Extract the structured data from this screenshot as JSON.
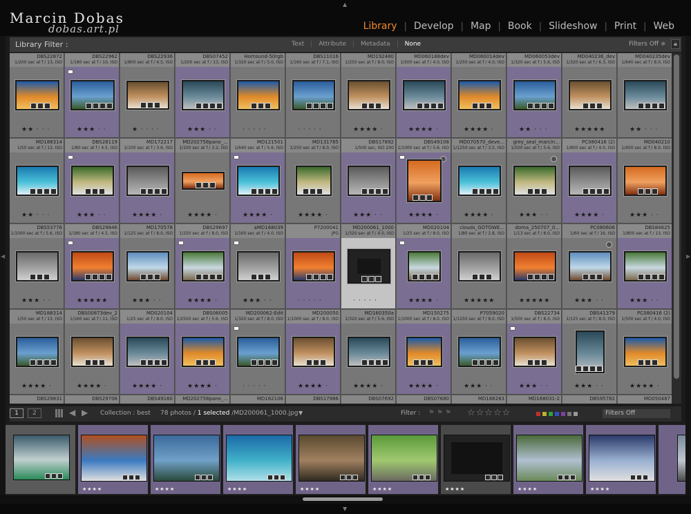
{
  "branding": {
    "name": "Marcin Dobas",
    "site": "dobas.art.pl"
  },
  "modules": [
    {
      "label": "Library",
      "active": true
    },
    {
      "label": "Develop"
    },
    {
      "label": "Map"
    },
    {
      "label": "Book"
    },
    {
      "label": "Slideshow"
    },
    {
      "label": "Print"
    },
    {
      "label": "Web"
    }
  ],
  "filter_bar": {
    "label": "Library Filter :",
    "options": [
      "Text",
      "Attribute",
      "Metadata",
      "None"
    ],
    "active": "None",
    "preset": "Filters Off ≑"
  },
  "grid": {
    "rows": [
      [
        {
          "name": "DBS22872",
          "exif": "1/200 sec at f / 13, ISO",
          "stars": 2
        },
        {
          "name": "DBS22962",
          "exif": "1/180 sec at f / 10, ISO",
          "stars": 3
        },
        {
          "name": "DBS22936",
          "exif": "1/800 sec at f / 4.5, ISO",
          "stars": 1
        },
        {
          "name": "DBS07452",
          "exif": "1/200 sec at f / 13, ISO",
          "stars": 3
        },
        {
          "name": "Hornsund-50rgb",
          "exif": "1/320 sec at f / 5.0, ISO",
          "stars": 0
        },
        {
          "name": "DBS11016",
          "exif": "1/160 sec at f / 7.1, ISO",
          "stars": 0
        },
        {
          "name": "MD192480",
          "exif": "1/250 sec at f / 8.0, ISO",
          "stars": 4
        },
        {
          "name": "MD060188dev",
          "exif": "1/500 sec at f / 4.0, ISO",
          "stars": 4
        },
        {
          "name": "MD060014dev",
          "exif": "1/250 sec at f / 4.0, ISO",
          "stars": 4
        },
        {
          "name": "MD060053dev",
          "exif": "1/320 sec at f / 5.6, ISO",
          "stars": 2
        },
        {
          "name": "MD040236_dev",
          "exif": "1/320 sec at f / 6.3, ISO",
          "stars": 5
        },
        {
          "name": "MD040235dev",
          "exif": "1/640 sec at f / 8.0, ISO",
          "stars": 2
        }
      ],
      [
        {
          "name": "MD188314",
          "exif": "1/50 sec at f / 13, ISO",
          "stars": 2
        },
        {
          "name": "DBS28119",
          "exif": "1/80 sec at f / 4.5, ISO",
          "stars": 3
        },
        {
          "name": "MD172217",
          "exif": "1/100 sec at f / 3.6, ISO",
          "stars": 4
        },
        {
          "name": "MD202758pano_...",
          "exif": "1/100 sec at f / 3.2, ISO",
          "stars": 4
        },
        {
          "name": "MD121501",
          "exif": "1/640 sec at f / 5.6, ISO",
          "stars": 4
        },
        {
          "name": "MD131785",
          "exif": "1/250 sec at f / 8.0, ISO",
          "stars": 4
        },
        {
          "name": "DBS17892",
          "exif": "1/500 sec, ISO 200",
          "stars": 3
        },
        {
          "name": "DBS49108",
          "exif": "1/1000 sec at f / 5.6, ISO",
          "stars": 4
        },
        {
          "name": "MD070570_deve...",
          "exif": "1/1250 sec at f / 3.5, ISO",
          "stars": 4
        },
        {
          "name": "grey_seal_marcin...",
          "exif": "1/500 sec at f / 5.6, ISO",
          "stars": 3
        },
        {
          "name": "PC080416 (2)",
          "exif": "1/800 sec at f / 4.0, ISO",
          "stars": 4
        },
        {
          "name": "MD040210",
          "exif": "1/400 sec at f / 8.0, ISO",
          "stars": 3
        }
      ],
      [
        {
          "name": "DBS53776",
          "exif": "1/1000 sec at f / 5.6, ISO",
          "stars": 3
        },
        {
          "name": "DBS29846",
          "exif": "1/180 sec at f / 4.5, ISO",
          "stars": 5
        },
        {
          "name": "MD170578",
          "exif": "1/125 sec at f / 8.0, ISO",
          "stars": 3
        },
        {
          "name": "DBS29697",
          "exif": "1/250 sec at f / 8.0, ISO",
          "stars": 4
        },
        {
          "name": "aMD168039",
          "exif": "1/160 sec at f / 4.0, ISO",
          "stars": 3
        },
        {
          "name": "P7200041",
          "exif": "JPG",
          "stars": 0
        },
        {
          "name": "MD200061_1000",
          "exif": "1/320 sec at f / 4.0, ISO",
          "stars": 0
        },
        {
          "name": "MD020104",
          "exif": "1/25 sec at f / 8.0, ISO",
          "stars": 4
        },
        {
          "name": "clouds_GOTOWE...",
          "exif": "1/80 sec at f / 2.8, ISO",
          "stars": 5
        },
        {
          "name": "doma_250707_0...",
          "exif": "1/13 sec at f / 8.0, ISO",
          "stars": 5
        },
        {
          "name": "PC080606",
          "exif": "1/60 sec at f / 16, ISO",
          "stars": 3
        },
        {
          "name": "DBS84625",
          "exif": "1/800 sec at f / 13, ISO",
          "stars": 3
        }
      ],
      [
        {
          "name": "MD188314",
          "exif": "1/50 sec at f / 13, ISO",
          "stars": 4
        },
        {
          "name": "DBS00873dev_2",
          "exif": "1/160 sec at f / 11, ISO",
          "stars": 4
        },
        {
          "name": "MD020104",
          "exif": "1/25 sec at f / 8.0, ISO",
          "stars": 4
        },
        {
          "name": "DBS06005",
          "exif": "1/2500 sec at f / 5.6, ISO",
          "stars": 4
        },
        {
          "name": "MD200062-Edit",
          "exif": "1/320 sec at f / 8.0, ISO",
          "stars": 0
        },
        {
          "name": "MD200050",
          "exif": "1/1000 sec at f / 8.0, ISO",
          "stars": 4
        },
        {
          "name": "MD160350a",
          "exif": "1/320 sec at f / 5.6, ISO",
          "stars": 4
        },
        {
          "name": "MD150275",
          "exif": "1/1000 sec at f / 8.0, ISO",
          "stars": 4
        },
        {
          "name": "P7059020",
          "exif": "1/1250 sec at f / 8.0, ISO",
          "stars": 3
        },
        {
          "name": "DBS22734",
          "exif": "1/500 sec at f / 8.0, ISO",
          "stars": 3
        },
        {
          "name": "DBS41379",
          "exif": "1/125 sec at f / 8.0, ISO",
          "stars": 3
        },
        {
          "name": "PC080416 (2)",
          "exif": "1/500 sec at f / 4.0, ISO",
          "stars": 4
        }
      ],
      [
        {
          "name": "DBS29831",
          "exif": "",
          "stars": 0
        },
        {
          "name": "DBS29706",
          "exif": "",
          "stars": 0
        },
        {
          "name": "DBS49160",
          "exif": "",
          "stars": 0
        },
        {
          "name": "MD202758pano_...",
          "exif": "",
          "stars": 0
        },
        {
          "name": "MD162106",
          "exif": "",
          "stars": 0
        },
        {
          "name": "DBS17986",
          "exif": "",
          "stars": 0
        },
        {
          "name": "DBS07692",
          "exif": "",
          "stars": 0
        },
        {
          "name": "DBS07680",
          "exif": "",
          "stars": 0
        },
        {
          "name": "MD188283",
          "exif": "",
          "stars": 0
        },
        {
          "name": "MD168031-2",
          "exif": "",
          "stars": 0
        },
        {
          "name": "DBS95782",
          "exif": "",
          "stars": 0
        },
        {
          "name": "MD050487",
          "exif": "",
          "stars": 0
        }
      ]
    ]
  },
  "toolbar": {
    "view1": "1",
    "view2": "2",
    "collection": "Collection : best",
    "photos_count": "78 photos /",
    "selected": "1 selected",
    "path": "/MD200061_1000.jpg",
    "filter_label": "Filter :",
    "stars": "☆☆☆☆☆",
    "preset": "Filters Off"
  },
  "filmstrip": [
    {
      "stars": ""
    },
    {
      "stars": "★★★★"
    },
    {
      "stars": "★★★★"
    },
    {
      "stars": "★★★★"
    },
    {
      "stars": "★★★★"
    },
    {
      "stars": "★★★★"
    },
    {
      "stars": "★★★★"
    },
    {
      "stars": "★★★★"
    },
    {
      "stars": "★★★★"
    },
    {
      "stars": ""
    }
  ],
  "colors": {
    "active_module": "#f4892b",
    "selected_cell": "#c4c4c4",
    "purple_cell": "#7a6e92",
    "label_red": "#c03030",
    "label_yellow": "#c0b030",
    "label_green": "#30a040",
    "label_blue": "#3050c0",
    "label_purple": "#8040a0"
  }
}
